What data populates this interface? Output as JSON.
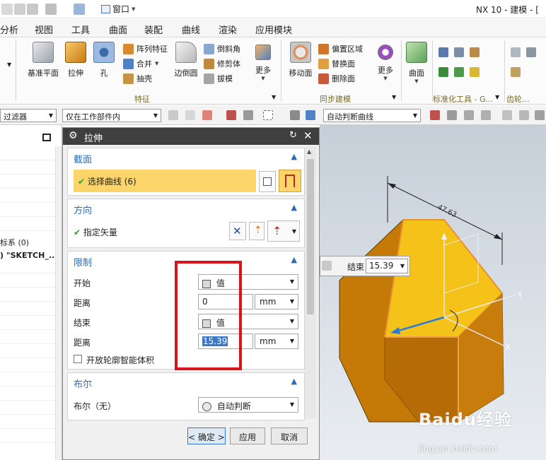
{
  "titlebar": {
    "window_menu": "窗口",
    "app_title": "NX 10 - 建模 - [",
    "colors": {
      "accent": "#3a78c9"
    }
  },
  "menu": {
    "tabs": [
      "分析",
      "视图",
      "工具",
      "曲面",
      "装配",
      "曲线",
      "渲染",
      "应用模块"
    ]
  },
  "ribbon": {
    "feature": {
      "datum_plane": "基准平面",
      "extrude": "拉伸",
      "hole": "孔",
      "pattern_feature": "阵列特征",
      "unite": "合并",
      "shell": "抽壳",
      "edge_blend": "边倒圆",
      "chamfer": "倒斜角",
      "trim_body": "修剪体",
      "draft": "拔模",
      "more": "更多",
      "group_label": "特征"
    },
    "sync": {
      "move_face": "移动面",
      "offset_region": "偏置区域",
      "replace_face": "替换面",
      "delete_face": "删除面",
      "more": "更多",
      "group_label": "同步建模"
    },
    "surface": {
      "surface": "曲面",
      "std_tools_label": "标准化工具 - G...",
      "gear_label": "齿轮..."
    }
  },
  "selbar": {
    "filter": "过滤器",
    "scope": "仅在工作部件内",
    "curve_rule": "自动判断曲线"
  },
  "navigator": {
    "rows": [
      "标系 (0)",
      ") \"SKETCH_..."
    ]
  },
  "dialog": {
    "title": "拉伸",
    "section_label": "截面",
    "select_curve": "选择曲线 (6)",
    "direction_label": "方向",
    "specify_vector": "指定矢量",
    "limits_label": "限制",
    "start_label": "开始",
    "start_value": "值",
    "start_distance_label": "距离",
    "start_distance": "0",
    "unit": "mm",
    "end_label": "结束",
    "end_value": "值",
    "end_distance_label": "距离",
    "end_distance": "15.39",
    "open_profile": "开放轮廓智能体积",
    "boolean_label": "布尔",
    "boolean_field_label": "布尔（无）",
    "boolean_value": "自动判断",
    "ok": "< 确定 >",
    "apply": "应用",
    "cancel": "取消"
  },
  "viewport": {
    "ondialog_label": "结束",
    "ondialog_value": "15.39",
    "dimension": "47.63",
    "axis_x": "X",
    "axis_y": "Y",
    "watermark": "Baidu经验",
    "watermark_url": "jingyan.baidu.com"
  }
}
